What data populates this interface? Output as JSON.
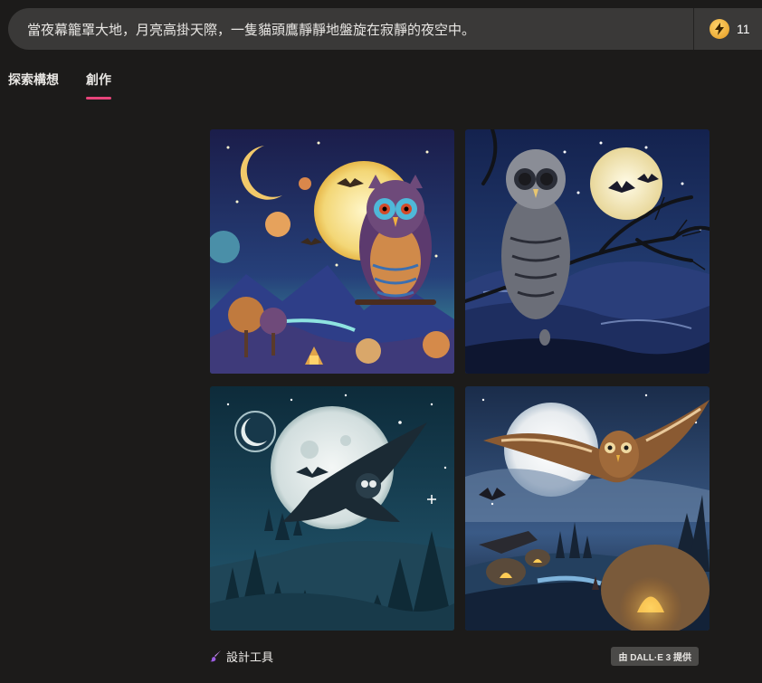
{
  "prompt": {
    "text": "當夜幕籠罩大地，月亮高掛天際，一隻貓頭鷹靜靜地盤旋在寂靜的夜空中。"
  },
  "boosts": {
    "count": "11",
    "icon": "lightning-bolt-icon",
    "color": "#f0a830"
  },
  "tabs": [
    {
      "label": "探索構想",
      "active": false
    },
    {
      "label": "創作",
      "active": true
    }
  ],
  "accent_color": "#e8447a",
  "images": [
    {
      "name": "owl-image-1"
    },
    {
      "name": "owl-image-2"
    },
    {
      "name": "owl-image-3"
    },
    {
      "name": "owl-image-4"
    }
  ],
  "footer": {
    "design_tools_label": "設計工具",
    "design_icon": "paint-brush-icon",
    "provider_badge": "由 DALL·E 3 提供"
  }
}
